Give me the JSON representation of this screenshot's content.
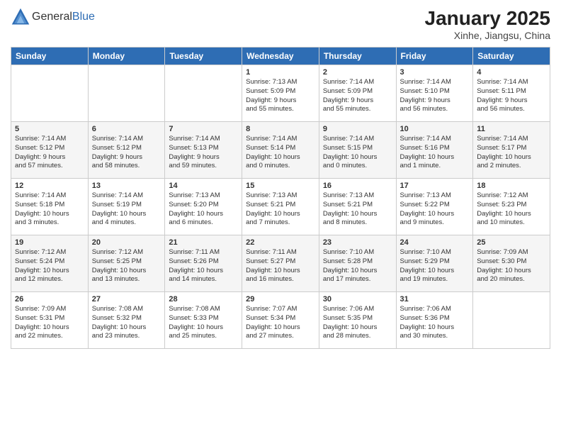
{
  "header": {
    "logo": {
      "general": "General",
      "blue": "Blue"
    },
    "title": "January 2025",
    "location": "Xinhe, Jiangsu, China"
  },
  "days_of_week": [
    "Sunday",
    "Monday",
    "Tuesday",
    "Wednesday",
    "Thursday",
    "Friday",
    "Saturday"
  ],
  "weeks": [
    [
      {
        "day": "",
        "info": ""
      },
      {
        "day": "",
        "info": ""
      },
      {
        "day": "",
        "info": ""
      },
      {
        "day": "1",
        "info": "Sunrise: 7:13 AM\nSunset: 5:09 PM\nDaylight: 9 hours\nand 55 minutes."
      },
      {
        "day": "2",
        "info": "Sunrise: 7:14 AM\nSunset: 5:09 PM\nDaylight: 9 hours\nand 55 minutes."
      },
      {
        "day": "3",
        "info": "Sunrise: 7:14 AM\nSunset: 5:10 PM\nDaylight: 9 hours\nand 56 minutes."
      },
      {
        "day": "4",
        "info": "Sunrise: 7:14 AM\nSunset: 5:11 PM\nDaylight: 9 hours\nand 56 minutes."
      }
    ],
    [
      {
        "day": "5",
        "info": "Sunrise: 7:14 AM\nSunset: 5:12 PM\nDaylight: 9 hours\nand 57 minutes."
      },
      {
        "day": "6",
        "info": "Sunrise: 7:14 AM\nSunset: 5:12 PM\nDaylight: 9 hours\nand 58 minutes."
      },
      {
        "day": "7",
        "info": "Sunrise: 7:14 AM\nSunset: 5:13 PM\nDaylight: 9 hours\nand 59 minutes."
      },
      {
        "day": "8",
        "info": "Sunrise: 7:14 AM\nSunset: 5:14 PM\nDaylight: 10 hours\nand 0 minutes."
      },
      {
        "day": "9",
        "info": "Sunrise: 7:14 AM\nSunset: 5:15 PM\nDaylight: 10 hours\nand 0 minutes."
      },
      {
        "day": "10",
        "info": "Sunrise: 7:14 AM\nSunset: 5:16 PM\nDaylight: 10 hours\nand 1 minute."
      },
      {
        "day": "11",
        "info": "Sunrise: 7:14 AM\nSunset: 5:17 PM\nDaylight: 10 hours\nand 2 minutes."
      }
    ],
    [
      {
        "day": "12",
        "info": "Sunrise: 7:14 AM\nSunset: 5:18 PM\nDaylight: 10 hours\nand 3 minutes."
      },
      {
        "day": "13",
        "info": "Sunrise: 7:14 AM\nSunset: 5:19 PM\nDaylight: 10 hours\nand 4 minutes."
      },
      {
        "day": "14",
        "info": "Sunrise: 7:13 AM\nSunset: 5:20 PM\nDaylight: 10 hours\nand 6 minutes."
      },
      {
        "day": "15",
        "info": "Sunrise: 7:13 AM\nSunset: 5:21 PM\nDaylight: 10 hours\nand 7 minutes."
      },
      {
        "day": "16",
        "info": "Sunrise: 7:13 AM\nSunset: 5:21 PM\nDaylight: 10 hours\nand 8 minutes."
      },
      {
        "day": "17",
        "info": "Sunrise: 7:13 AM\nSunset: 5:22 PM\nDaylight: 10 hours\nand 9 minutes."
      },
      {
        "day": "18",
        "info": "Sunrise: 7:12 AM\nSunset: 5:23 PM\nDaylight: 10 hours\nand 10 minutes."
      }
    ],
    [
      {
        "day": "19",
        "info": "Sunrise: 7:12 AM\nSunset: 5:24 PM\nDaylight: 10 hours\nand 12 minutes."
      },
      {
        "day": "20",
        "info": "Sunrise: 7:12 AM\nSunset: 5:25 PM\nDaylight: 10 hours\nand 13 minutes."
      },
      {
        "day": "21",
        "info": "Sunrise: 7:11 AM\nSunset: 5:26 PM\nDaylight: 10 hours\nand 14 minutes."
      },
      {
        "day": "22",
        "info": "Sunrise: 7:11 AM\nSunset: 5:27 PM\nDaylight: 10 hours\nand 16 minutes."
      },
      {
        "day": "23",
        "info": "Sunrise: 7:10 AM\nSunset: 5:28 PM\nDaylight: 10 hours\nand 17 minutes."
      },
      {
        "day": "24",
        "info": "Sunrise: 7:10 AM\nSunset: 5:29 PM\nDaylight: 10 hours\nand 19 minutes."
      },
      {
        "day": "25",
        "info": "Sunrise: 7:09 AM\nSunset: 5:30 PM\nDaylight: 10 hours\nand 20 minutes."
      }
    ],
    [
      {
        "day": "26",
        "info": "Sunrise: 7:09 AM\nSunset: 5:31 PM\nDaylight: 10 hours\nand 22 minutes."
      },
      {
        "day": "27",
        "info": "Sunrise: 7:08 AM\nSunset: 5:32 PM\nDaylight: 10 hours\nand 23 minutes."
      },
      {
        "day": "28",
        "info": "Sunrise: 7:08 AM\nSunset: 5:33 PM\nDaylight: 10 hours\nand 25 minutes."
      },
      {
        "day": "29",
        "info": "Sunrise: 7:07 AM\nSunset: 5:34 PM\nDaylight: 10 hours\nand 27 minutes."
      },
      {
        "day": "30",
        "info": "Sunrise: 7:06 AM\nSunset: 5:35 PM\nDaylight: 10 hours\nand 28 minutes."
      },
      {
        "day": "31",
        "info": "Sunrise: 7:06 AM\nSunset: 5:36 PM\nDaylight: 10 hours\nand 30 minutes."
      },
      {
        "day": "",
        "info": ""
      }
    ]
  ]
}
